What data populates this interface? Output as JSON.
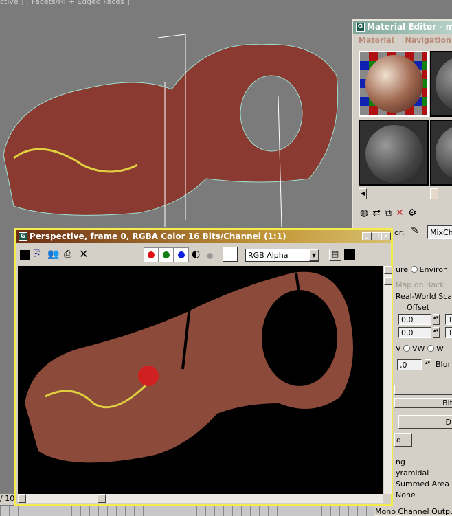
{
  "viewport": {
    "label": "ctive ] [ Facets/HI + Edged Faces ]",
    "frame_counter": "/ 10"
  },
  "material_editor": {
    "title": "Material Editor - mood",
    "menu": [
      "Material",
      "Navigation"
    ],
    "map_name": "MixCho",
    "map_label": "or:",
    "radio_texture": "ure",
    "radio_environ": "Environ",
    "show_map_on_back": "Map on Back",
    "real_world_scale": "Real-World Scale",
    "offset_label": "Offset",
    "offset_u": "0,0",
    "offset_v": "0,0",
    "tiling_u": "1",
    "tiling_v": "1",
    "axis_v": "V",
    "axis_vw": "VW",
    "axis_w": "W",
    "blur_value": ",0",
    "blur_label": "Blur o",
    "rollout_bitmap": "Bit",
    "bitmap_button": "D",
    "reload_button": "d",
    "filtering_label": "ng",
    "filter_pyramidal": "yramidal",
    "filter_summed": "Summed Area",
    "filter_none": "None",
    "mono_output": "Mono Channel Output:"
  },
  "frame_window": {
    "title": "Perspective, frame 0, RGBA Color 16 Bits/Channel (1:1)",
    "channel_select": "RGB Alpha",
    "colors": {
      "red": "#e01010",
      "green": "#108010",
      "blue": "#1020e0",
      "border": "#f4ec4c"
    }
  }
}
